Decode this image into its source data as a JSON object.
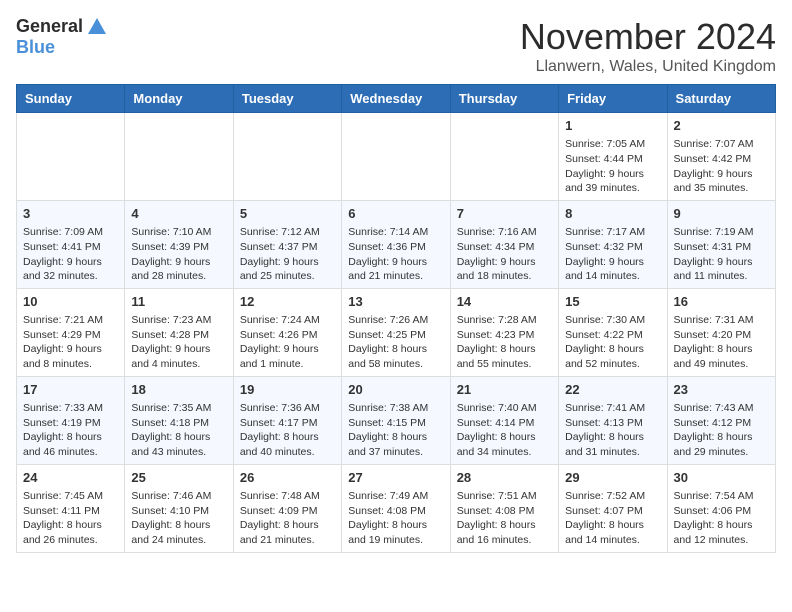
{
  "logo": {
    "line1": "General",
    "line2": "Blue"
  },
  "title": "November 2024",
  "location": "Llanwern, Wales, United Kingdom",
  "days_of_week": [
    "Sunday",
    "Monday",
    "Tuesday",
    "Wednesday",
    "Thursday",
    "Friday",
    "Saturday"
  ],
  "weeks": [
    [
      {
        "day": "",
        "info": ""
      },
      {
        "day": "",
        "info": ""
      },
      {
        "day": "",
        "info": ""
      },
      {
        "day": "",
        "info": ""
      },
      {
        "day": "",
        "info": ""
      },
      {
        "day": "1",
        "info": "Sunrise: 7:05 AM\nSunset: 4:44 PM\nDaylight: 9 hours\nand 39 minutes."
      },
      {
        "day": "2",
        "info": "Sunrise: 7:07 AM\nSunset: 4:42 PM\nDaylight: 9 hours\nand 35 minutes."
      }
    ],
    [
      {
        "day": "3",
        "info": "Sunrise: 7:09 AM\nSunset: 4:41 PM\nDaylight: 9 hours\nand 32 minutes."
      },
      {
        "day": "4",
        "info": "Sunrise: 7:10 AM\nSunset: 4:39 PM\nDaylight: 9 hours\nand 28 minutes."
      },
      {
        "day": "5",
        "info": "Sunrise: 7:12 AM\nSunset: 4:37 PM\nDaylight: 9 hours\nand 25 minutes."
      },
      {
        "day": "6",
        "info": "Sunrise: 7:14 AM\nSunset: 4:36 PM\nDaylight: 9 hours\nand 21 minutes."
      },
      {
        "day": "7",
        "info": "Sunrise: 7:16 AM\nSunset: 4:34 PM\nDaylight: 9 hours\nand 18 minutes."
      },
      {
        "day": "8",
        "info": "Sunrise: 7:17 AM\nSunset: 4:32 PM\nDaylight: 9 hours\nand 14 minutes."
      },
      {
        "day": "9",
        "info": "Sunrise: 7:19 AM\nSunset: 4:31 PM\nDaylight: 9 hours\nand 11 minutes."
      }
    ],
    [
      {
        "day": "10",
        "info": "Sunrise: 7:21 AM\nSunset: 4:29 PM\nDaylight: 9 hours\nand 8 minutes."
      },
      {
        "day": "11",
        "info": "Sunrise: 7:23 AM\nSunset: 4:28 PM\nDaylight: 9 hours\nand 4 minutes."
      },
      {
        "day": "12",
        "info": "Sunrise: 7:24 AM\nSunset: 4:26 PM\nDaylight: 9 hours\nand 1 minute."
      },
      {
        "day": "13",
        "info": "Sunrise: 7:26 AM\nSunset: 4:25 PM\nDaylight: 8 hours\nand 58 minutes."
      },
      {
        "day": "14",
        "info": "Sunrise: 7:28 AM\nSunset: 4:23 PM\nDaylight: 8 hours\nand 55 minutes."
      },
      {
        "day": "15",
        "info": "Sunrise: 7:30 AM\nSunset: 4:22 PM\nDaylight: 8 hours\nand 52 minutes."
      },
      {
        "day": "16",
        "info": "Sunrise: 7:31 AM\nSunset: 4:20 PM\nDaylight: 8 hours\nand 49 minutes."
      }
    ],
    [
      {
        "day": "17",
        "info": "Sunrise: 7:33 AM\nSunset: 4:19 PM\nDaylight: 8 hours\nand 46 minutes."
      },
      {
        "day": "18",
        "info": "Sunrise: 7:35 AM\nSunset: 4:18 PM\nDaylight: 8 hours\nand 43 minutes."
      },
      {
        "day": "19",
        "info": "Sunrise: 7:36 AM\nSunset: 4:17 PM\nDaylight: 8 hours\nand 40 minutes."
      },
      {
        "day": "20",
        "info": "Sunrise: 7:38 AM\nSunset: 4:15 PM\nDaylight: 8 hours\nand 37 minutes."
      },
      {
        "day": "21",
        "info": "Sunrise: 7:40 AM\nSunset: 4:14 PM\nDaylight: 8 hours\nand 34 minutes."
      },
      {
        "day": "22",
        "info": "Sunrise: 7:41 AM\nSunset: 4:13 PM\nDaylight: 8 hours\nand 31 minutes."
      },
      {
        "day": "23",
        "info": "Sunrise: 7:43 AM\nSunset: 4:12 PM\nDaylight: 8 hours\nand 29 minutes."
      }
    ],
    [
      {
        "day": "24",
        "info": "Sunrise: 7:45 AM\nSunset: 4:11 PM\nDaylight: 8 hours\nand 26 minutes."
      },
      {
        "day": "25",
        "info": "Sunrise: 7:46 AM\nSunset: 4:10 PM\nDaylight: 8 hours\nand 24 minutes."
      },
      {
        "day": "26",
        "info": "Sunrise: 7:48 AM\nSunset: 4:09 PM\nDaylight: 8 hours\nand 21 minutes."
      },
      {
        "day": "27",
        "info": "Sunrise: 7:49 AM\nSunset: 4:08 PM\nDaylight: 8 hours\nand 19 minutes."
      },
      {
        "day": "28",
        "info": "Sunrise: 7:51 AM\nSunset: 4:08 PM\nDaylight: 8 hours\nand 16 minutes."
      },
      {
        "day": "29",
        "info": "Sunrise: 7:52 AM\nSunset: 4:07 PM\nDaylight: 8 hours\nand 14 minutes."
      },
      {
        "day": "30",
        "info": "Sunrise: 7:54 AM\nSunset: 4:06 PM\nDaylight: 8 hours\nand 12 minutes."
      }
    ]
  ]
}
